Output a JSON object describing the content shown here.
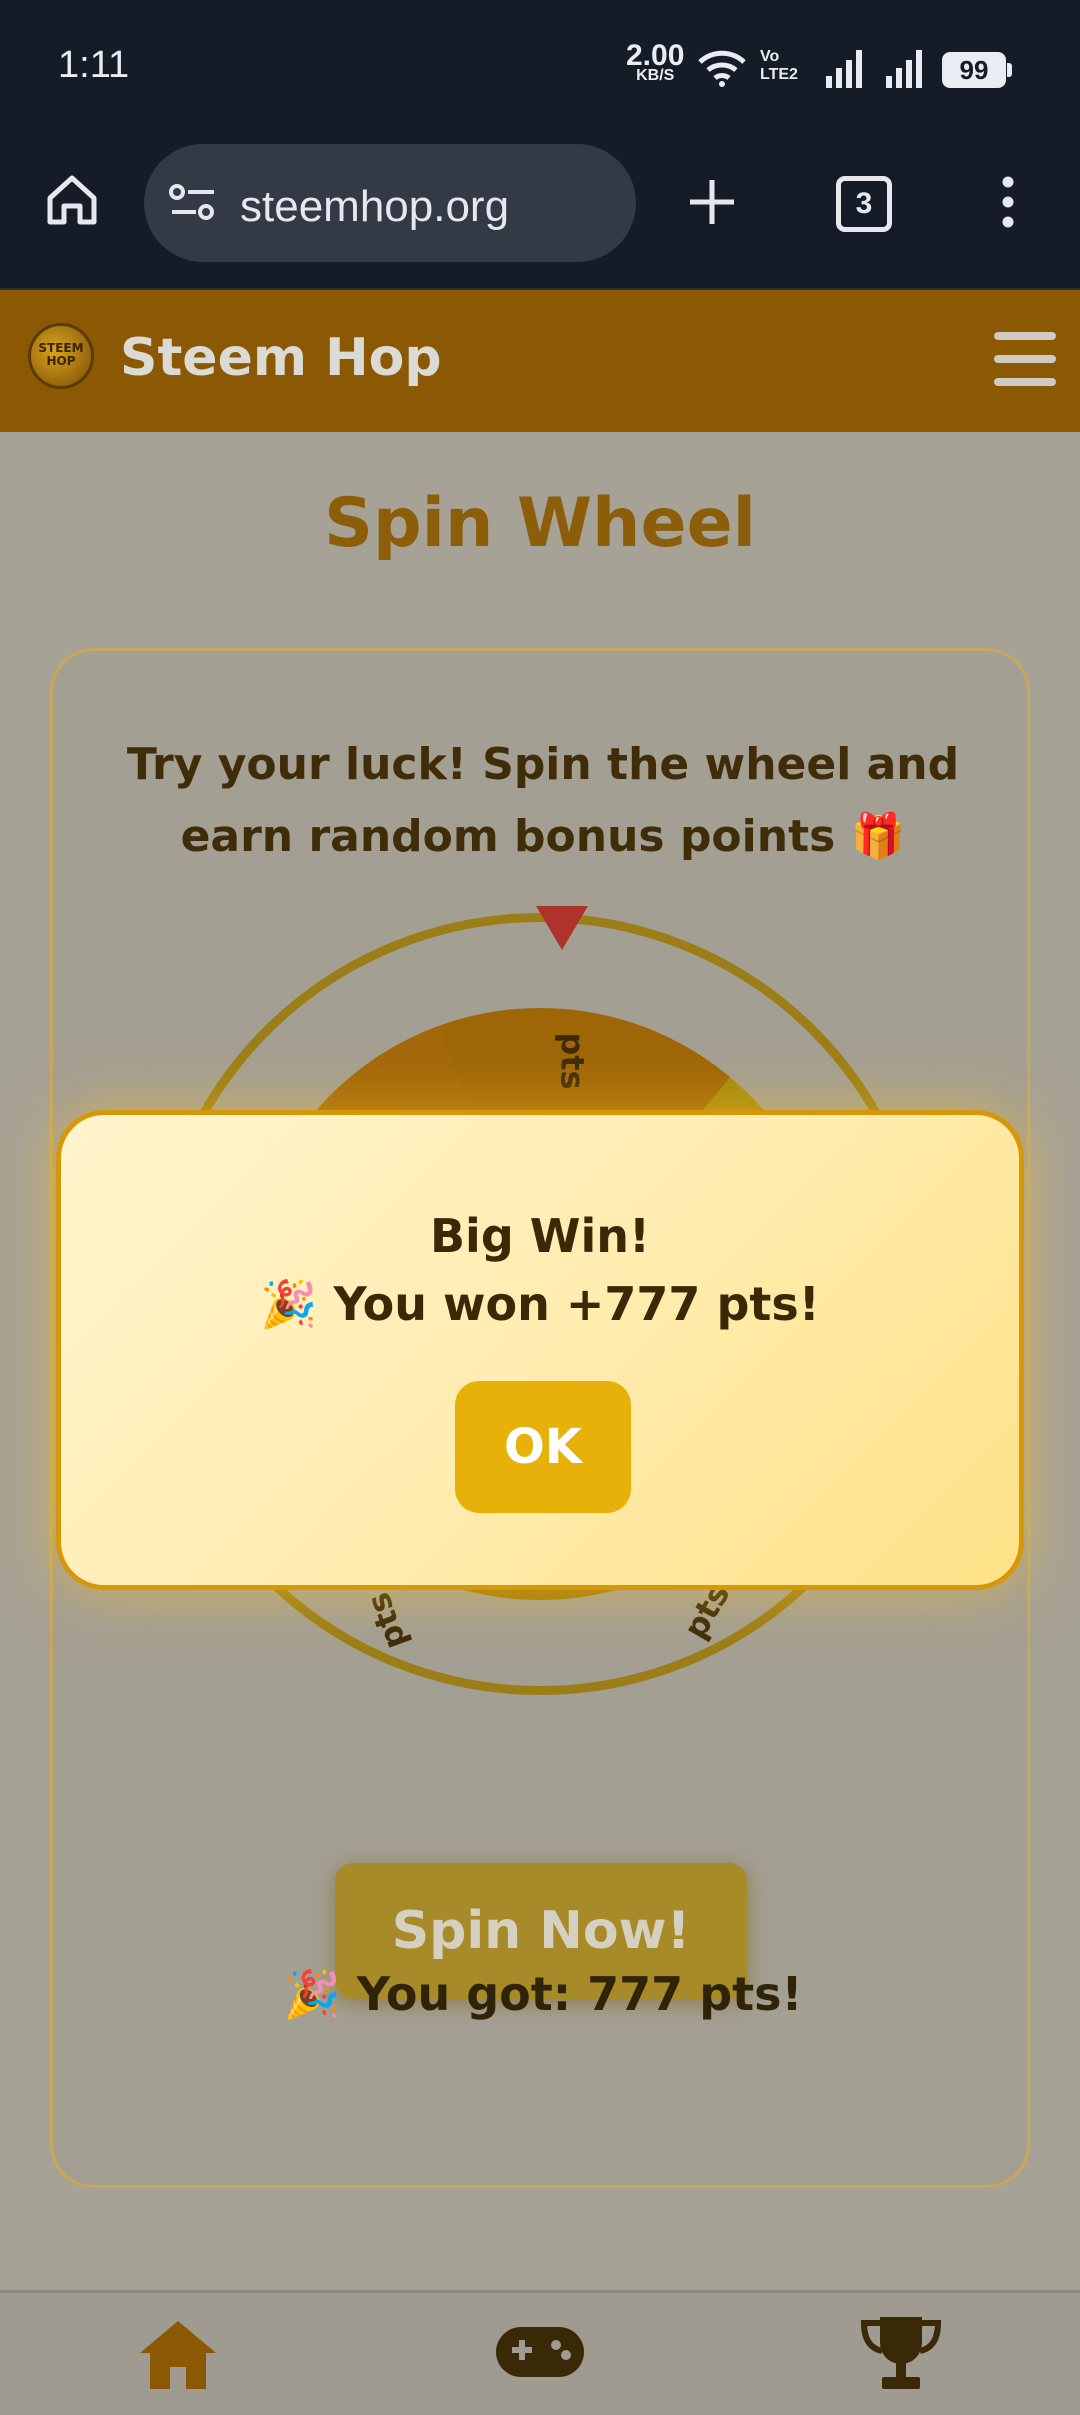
{
  "status": {
    "time": "1:11",
    "speed": "2.00",
    "speed_unit": "KB/S",
    "volte": "Vo LTE2",
    "battery": "99"
  },
  "browser": {
    "url": "steemhop.org",
    "tab_count": "3"
  },
  "app": {
    "title": "Steem Hop",
    "logo_text": "STEEM HOP"
  },
  "page": {
    "title": "Spin Wheel",
    "intro": "Try your luck! Spin the wheel and earn random bonus points 🎁",
    "spin_button": "Spin Now!",
    "result": "🎉 You got: 777 pts!",
    "wheel_labels": [
      "pts",
      "pts",
      "pts"
    ]
  },
  "modal": {
    "heading": "Big Win!",
    "message": "🎉 You won +777 pts!",
    "ok_label": "OK"
  },
  "bottom_nav": {
    "items": [
      "home",
      "games",
      "leaderboard"
    ]
  },
  "colors": {
    "header": "#8b5804",
    "accent": "#e8b10a",
    "title": "#8d5e09"
  }
}
